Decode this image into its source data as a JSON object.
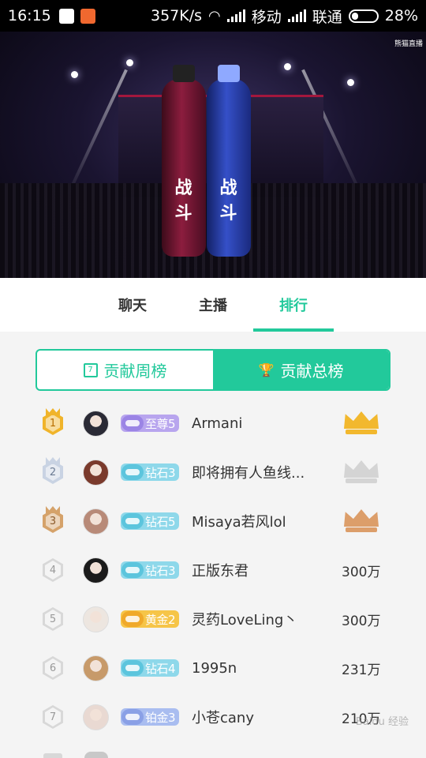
{
  "status_bar": {
    "time": "16:15",
    "speed": "357K/s",
    "carrier1": "移动",
    "carrier2": "联通",
    "battery": "28%",
    "battery_level": 0.28
  },
  "video": {
    "watermark": "熊猫直播",
    "bottle_text": "战斗"
  },
  "tabs": [
    {
      "label": "聊天",
      "active": false
    },
    {
      "label": "主播",
      "active": false
    },
    {
      "label": "排行",
      "active": true
    }
  ],
  "segment": {
    "weekly": "贡献周榜",
    "weekly_icon_text": "7",
    "total": "贡献总榜",
    "selected": "total"
  },
  "ranking": [
    {
      "rank": "1",
      "medal": "gold",
      "badge_type": "zhizun",
      "level": "至尊5",
      "name": "Armani",
      "value": "",
      "crown": "gold",
      "avatar_color": "#2a2a35"
    },
    {
      "rank": "2",
      "medal": "silver",
      "badge_type": "zuanshi",
      "level": "钻石3",
      "name": "即将拥有人鱼线...",
      "value": "",
      "crown": "silver",
      "avatar_color": "#7a3a2c"
    },
    {
      "rank": "3",
      "medal": "bronze",
      "badge_type": "zuanshi",
      "level": "钻石5",
      "name": "Misaya若风lol",
      "value": "",
      "crown": "bronze",
      "avatar_color": "#b88a78"
    },
    {
      "rank": "4",
      "medal": "plain",
      "badge_type": "zuanshi",
      "level": "钻石3",
      "name": "正版东君",
      "value": "300万",
      "crown": "",
      "avatar_color": "#1b1b1b"
    },
    {
      "rank": "5",
      "medal": "plain",
      "badge_type": "huangjin",
      "level": "黄金2",
      "name": "灵药LoveLing丶",
      "value": "300万",
      "crown": "",
      "avatar_color": "#ede6e0"
    },
    {
      "rank": "6",
      "medal": "plain",
      "badge_type": "zuanshi",
      "level": "钻石4",
      "name": "1995n",
      "value": "231万",
      "crown": "",
      "avatar_color": "#c79a6a"
    },
    {
      "rank": "7",
      "medal": "plain",
      "badge_type": "bojin",
      "level": "铂金3",
      "name": "小苍cany",
      "value": "210万",
      "crown": "",
      "avatar_color": "#e9d9d2"
    }
  ],
  "colors": {
    "accent": "#22c99b"
  }
}
